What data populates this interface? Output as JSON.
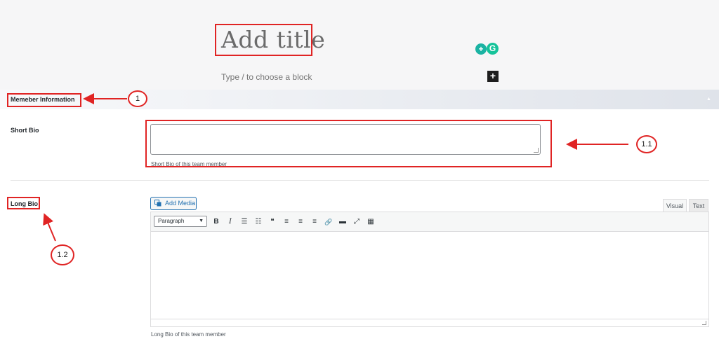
{
  "editor": {
    "title_placeholder": "Add title",
    "block_hint": "Type / to choose a block",
    "add_block_symbol": "+",
    "extensions": [
      "lightbulb-icon",
      "grammarly-icon"
    ],
    "extension_glyphs": [
      "+",
      "G"
    ]
  },
  "metabox": {
    "title": "Memeber Information",
    "toggle_symbol": "▲"
  },
  "short_bio": {
    "label": "Short Bio",
    "value": "",
    "description": "Short Bio of this team member"
  },
  "long_bio": {
    "label": "Long Bio",
    "add_media_label": "Add Media",
    "tabs": [
      "Visual",
      "Text"
    ],
    "active_tab": "Visual",
    "format_select": "Paragraph",
    "toolbar": {
      "bold": "B",
      "italic": "I",
      "bullet_list": "☰",
      "numbered_list": "☷",
      "blockquote": "❝",
      "align_left": "≡",
      "align_center": "≡",
      "align_right": "≡",
      "link": "🔗",
      "read_more": "▬",
      "fullscreen": "⤢",
      "toolbar_toggle": "▦"
    },
    "description": "Long Bio of this team member"
  },
  "annotations": {
    "a1": "1",
    "a11": "1.1",
    "a12": "1.2",
    "color": "#e02424"
  }
}
